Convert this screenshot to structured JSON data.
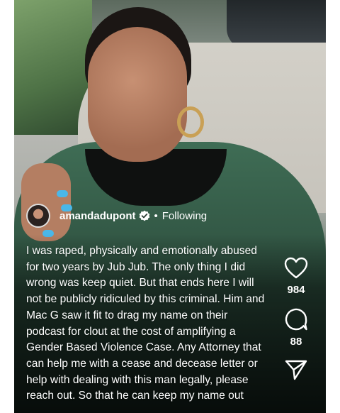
{
  "post": {
    "username": "amandadupont",
    "separator": "•",
    "follow_status": "Following",
    "caption": "I was raped, physically and emotionally abused for two years by Jub Jub. The only thing I did wrong was keep quiet. But that ends here I will not be publicly ridiculed by this criminal. Him and Mac G saw it fit to drag my name on their podcast for clout at the cost of amplifying a Gender Based Violence Case. Any Attorney that can help me with a cease and decease letter or help with dealing with this man legally, please reach out. So that he can keep my name out"
  },
  "actions": {
    "like_icon": "heart-icon",
    "like_count": "984",
    "comment_icon": "comment-bubble-icon",
    "comment_count": "88",
    "share_icon": "paper-plane-icon"
  },
  "colors": {
    "text": "#ffffff",
    "verified": "#ffffff"
  }
}
